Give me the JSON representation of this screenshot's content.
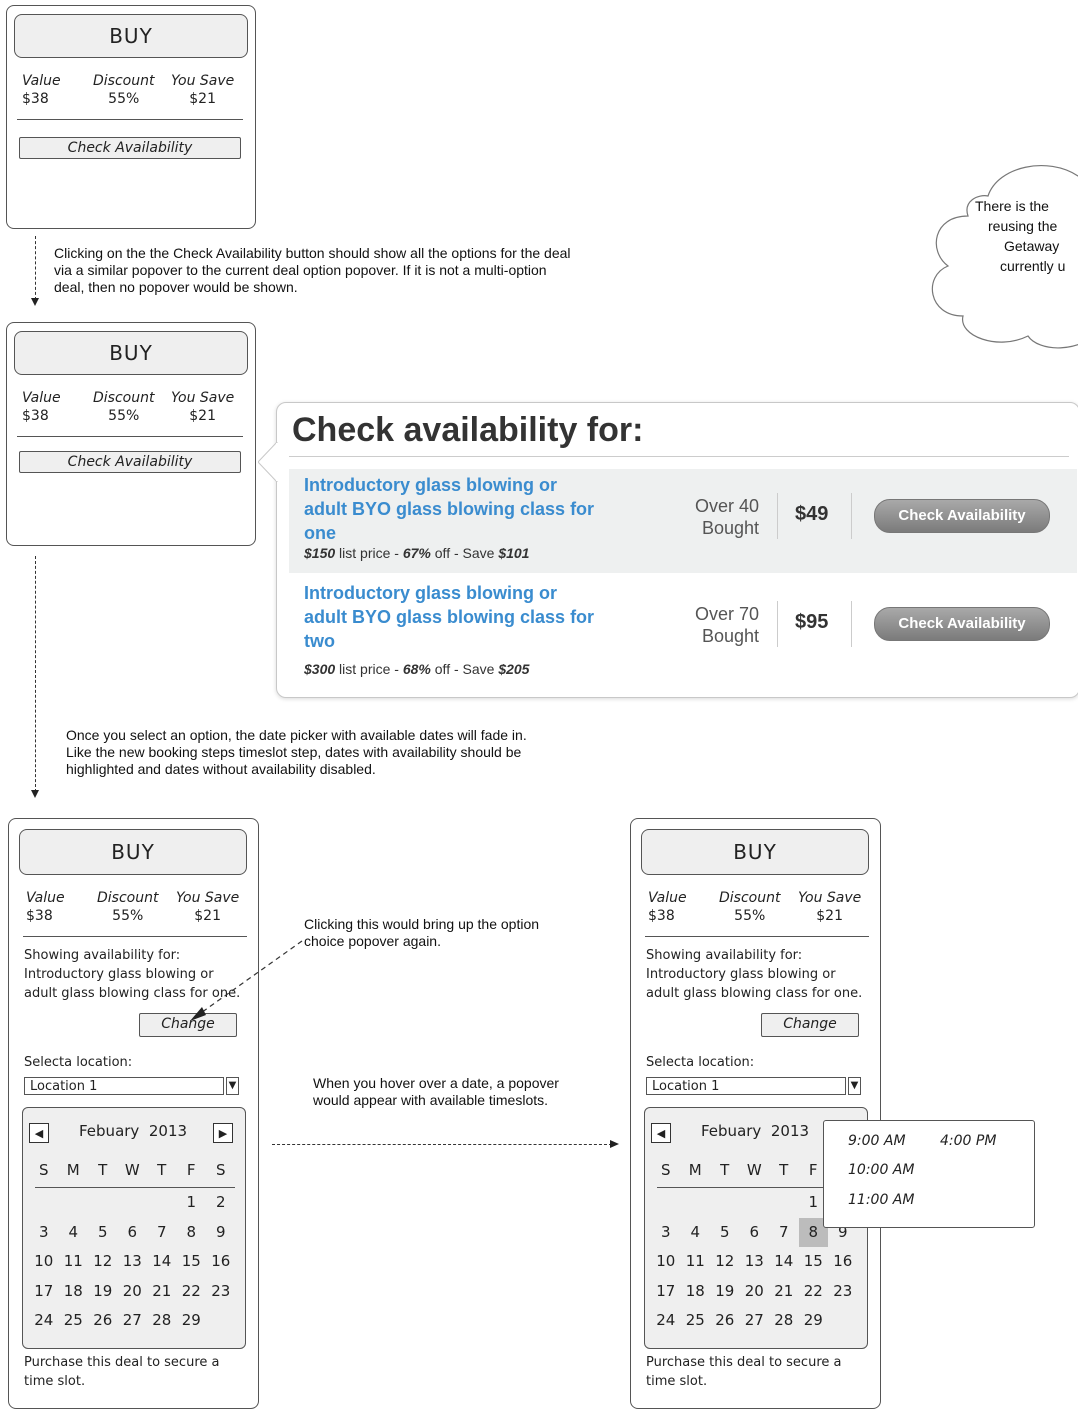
{
  "buy_label": "BUY",
  "stats": {
    "value_label": "Value",
    "value": "$38",
    "discount_label": "Discount",
    "discount": "55%",
    "save_label": "You Save",
    "save": "$21"
  },
  "check_availability_label": "Check Availability",
  "notes": {
    "note1": "Clicking on the the Check Availability button should show all the options for the deal via a similar popover to the current deal option popover. If it is not a multi-option deal, then no popover would be shown.",
    "note2": "Once you select an option, the date picker with available dates will fade in. Like the new booking steps timeslot step, dates with availability should be highlighted and dates without availability disabled.",
    "note3": "Clicking this would bring up the option choice popover again.",
    "note4": "When you hover over a date, a popover would appear with available timeslots.",
    "cloud_lines": [
      "There is the",
      "reusing the",
      "Getaway",
      "currently u"
    ]
  },
  "popover": {
    "title": "Check availability for:",
    "options": [
      {
        "title": "Introductory glass blowing or adult BYO glass blowing class for one",
        "list_price": "$150",
        "list_text": " list price - ",
        "pct": "67%",
        "off_text": " off - Save ",
        "save": "$101",
        "bought_line1": "Over 40",
        "bought_line2": "Bought",
        "price": "$49",
        "button": "Check Availability"
      },
      {
        "title": "Introductory glass blowing or adult BYO glass blowing class for two",
        "list_price": "$300",
        "list_text": " list price - ",
        "pct": "68%",
        "off_text": " off - Save ",
        "save": "$205",
        "bought_line1": "Over 70",
        "bought_line2": "Bought",
        "price": "$95",
        "button": "Check Availability"
      }
    ]
  },
  "booking": {
    "showing_line1": "Showing availability for:",
    "showing_line2": "Introductory glass blowing or",
    "showing_line3": "adult glass blowing class for one.",
    "change_label": "Change",
    "location_label": "Selecta location:",
    "location_value": "Location 1",
    "month": "Febuary",
    "year": "2013",
    "weekdays": [
      "S",
      "M",
      "T",
      "W",
      "T",
      "F",
      "S"
    ],
    "footer_line1": "Purchase this deal to secure a",
    "footer_line2": "time slot.",
    "highlighted_date": "8"
  },
  "timeslots": [
    "9:00 AM",
    "4:00 PM",
    "10:00 AM",
    "11:00 AM"
  ]
}
